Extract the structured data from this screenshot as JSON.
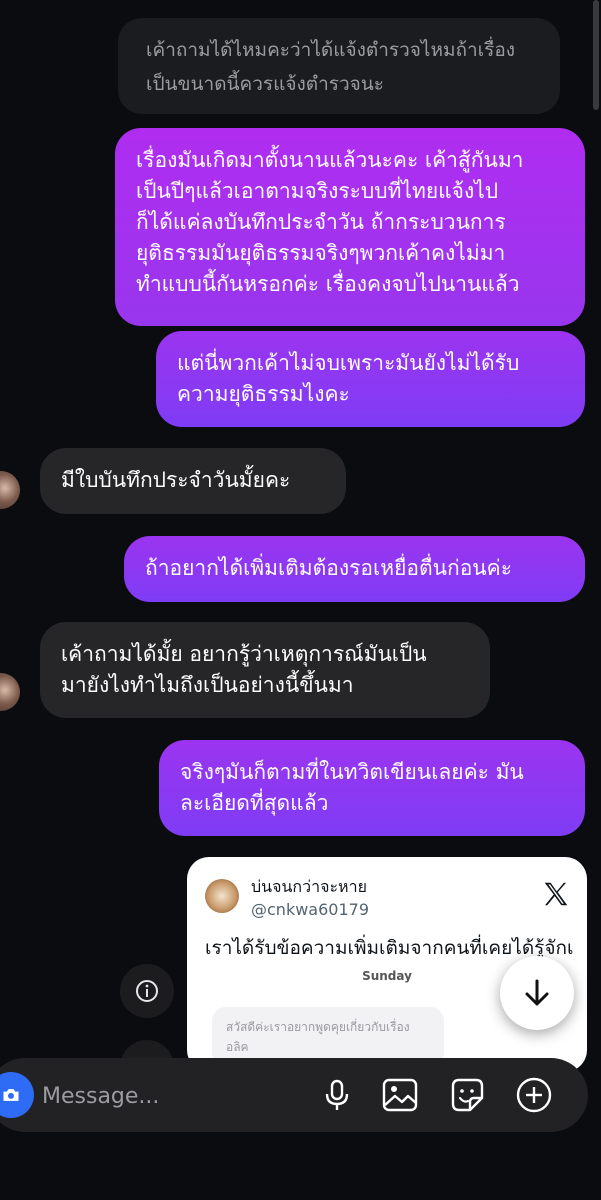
{
  "messages": [
    {
      "id": "q1",
      "text": "เค้าถามได้ไหมคะว่าได้แจ้งตำรวจไหมถ้าเรื่อง\nเป็นขนาดนี้ควรแจ้งตำรวจนะ"
    },
    {
      "id": "o1",
      "text": "เรื่องมันเกิดมาตั้งนานแล้วนะคะ เค้าสู้กันมา\nเป็นปีๆแล้วเอาตามจริงระบบที่ไทยแจ้งไป\nก็ได้แค่ลงบันทึกประจำวัน ถ้ากระบวนการ\nยุติธรรมมันยุติธรรมจริงๆพวกเค้าคงไม่มา\nทำแบบนี้กันหรอกค่ะ เรื่องคงจบไปนานแล้ว"
    },
    {
      "id": "o2",
      "text": "แต่นี่พวกเค้าไม่จบเพราะมันยังไม่ได้รับ\nความยุติธรรมไงคะ"
    },
    {
      "id": "i1",
      "text": "มีใบบันทึกประจำวันมั้ยคะ"
    },
    {
      "id": "o3",
      "text": "ถ้าอยากได้เพิ่มเติมต้องรอเหยื่อตื่นก่อนค่ะ"
    },
    {
      "id": "i2",
      "text": "เค้าถามได้มั้ย อยากรู้ว่าเหตุการณ์มันเป็น\nมายังไงทำไมถึงเป็นอย่างนี้ขึ้นมา"
    },
    {
      "id": "o4",
      "text": "จริงๆมันก็ตามที่ในทวิตเขียนเลยค่ะ มัน\nละเอียดที่สุดแล้ว"
    }
  ],
  "tweet": {
    "name": "บ่นจนกว่าจะหาย",
    "handle": "@cnkwa60179",
    "text": "เราได้รับข้อความเพิ่มเติมจากคนที่เคยได้รู้จักเ",
    "day": "Sunday",
    "inner_text": "สวัสดีค่ะเราอยากพูดคุยเกี่ยวกับเรื่อง\nอลิค"
  },
  "composer": {
    "placeholder": "Message..."
  },
  "icons": {
    "camera": "camera-icon",
    "mic": "microphone-icon",
    "gallery": "gallery-icon",
    "sticker": "sticker-icon",
    "plus": "plus-icon",
    "info": "info-icon",
    "scroll_down": "arrow-down-icon",
    "x_logo": "x-logo-icon"
  },
  "colors": {
    "outgoing_top": "#b02df0",
    "outgoing_bottom": "#7f3cf5",
    "incoming": "#262629",
    "camera": "#2f6cf5"
  }
}
